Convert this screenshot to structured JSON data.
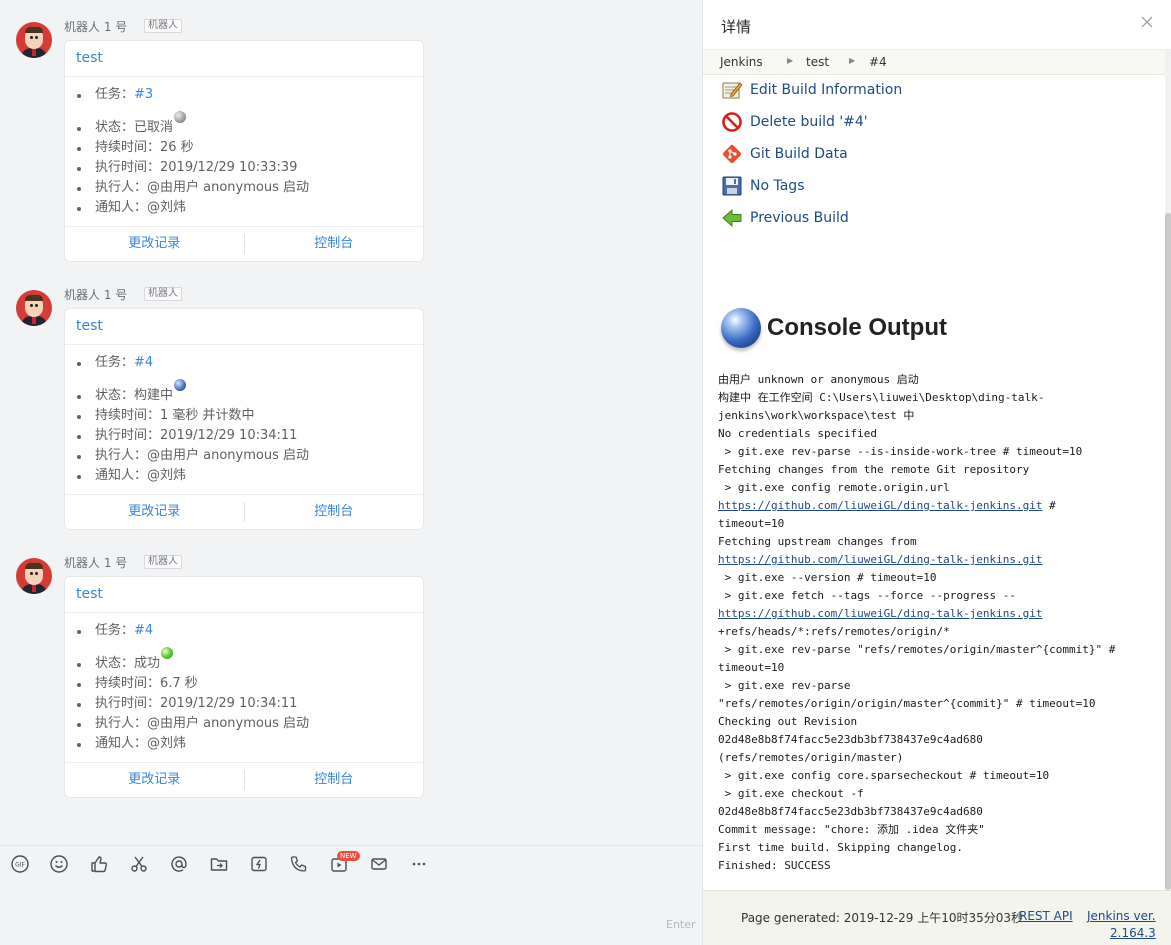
{
  "chat": {
    "messages": [
      {
        "sender": "机器人 1 号",
        "tag": "机器人",
        "title": "test",
        "task_label": "任务：",
        "task_link": "#3",
        "status_label": "状态：",
        "status": "已取消",
        "status_ball": "gray",
        "duration": "持续时间：26 秒",
        "exec_time": "执行时间：2019/12/29 10:33:39",
        "executor": "执行人：@由用户 anonymous 启动",
        "notify": "通知人：@刘炜",
        "btn_changes": "更改记录",
        "btn_console": "控制台"
      },
      {
        "sender": "机器人 1 号",
        "tag": "机器人",
        "title": "test",
        "task_label": "任务：",
        "task_link": "#4",
        "status_label": "状态：",
        "status": "构建中",
        "status_ball": "blue",
        "duration": "持续时间：1 毫秒 并计数中",
        "exec_time": "执行时间：2019/12/29 10:34:11",
        "executor": "执行人：@由用户 anonymous 启动",
        "notify": "通知人：@刘炜",
        "btn_changes": "更改记录",
        "btn_console": "控制台"
      },
      {
        "sender": "机器人 1 号",
        "tag": "机器人",
        "title": "test",
        "task_label": "任务：",
        "task_link": "#4",
        "status_label": "状态：",
        "status": "成功",
        "status_ball": "green",
        "duration": "持续时间：6.7 秒",
        "exec_time": "执行时间：2019/12/29 10:34:11",
        "executor": "执行人：@由用户 anonymous 启动",
        "notify": "通知人：@刘炜",
        "btn_changes": "更改记录",
        "btn_console": "控制台"
      }
    ],
    "toolbar": {
      "icons": [
        "gif-icon",
        "emoji-icon",
        "thumbs-up-icon",
        "scissors-icon",
        "mention-icon",
        "folder-upload-icon",
        "flash-icon",
        "phone-icon",
        "video-icon",
        "mail-icon",
        "more-icon"
      ],
      "new_badge": "NEW",
      "enter_hint": "Enter"
    }
  },
  "panel": {
    "title": "详情",
    "close_icon": "close-icon",
    "breadcrumbs": [
      "Jenkins",
      "test",
      "#4"
    ],
    "tasks": [
      {
        "label": "Edit Build Information",
        "icon": "notepad-icon"
      },
      {
        "label": "Delete build '#4'",
        "icon": "no-entry-icon"
      },
      {
        "label": "Git Build Data",
        "icon": "git-icon"
      },
      {
        "label": "No Tags",
        "icon": "save-icon"
      },
      {
        "label": "Previous Build",
        "icon": "arrow-left-icon"
      }
    ],
    "console_title": "Console Output",
    "console_lines": [
      {
        "text": "由用户 unknown or anonymous 启动",
        "link": false
      },
      {
        "text": "构建中 在工作空间 C:\\Users\\liuwei\\Desktop\\ding-talk-",
        "link": false
      },
      {
        "text": "jenkins\\work\\workspace\\test 中",
        "link": false
      },
      {
        "text": "No credentials specified",
        "link": false
      },
      {
        "text": " > git.exe rev-parse --is-inside-work-tree # timeout=10",
        "link": false
      },
      {
        "text": "Fetching changes from the remote Git repository",
        "link": false
      },
      {
        "text": " > git.exe config remote.origin.url",
        "link": false
      },
      {
        "text": "https://github.com/liuweiGL/ding-talk-jenkins.git",
        "link": true,
        "suffix": " #"
      },
      {
        "text": "timeout=10",
        "link": false
      },
      {
        "text": "Fetching upstream changes from",
        "link": false
      },
      {
        "text": "https://github.com/liuweiGL/ding-talk-jenkins.git",
        "link": true,
        "suffix": ""
      },
      {
        "text": " > git.exe --version # timeout=10",
        "link": false
      },
      {
        "text": " > git.exe fetch --tags --force --progress --",
        "link": false
      },
      {
        "text": "https://github.com/liuweiGL/ding-talk-jenkins.git",
        "link": true,
        "suffix": ""
      },
      {
        "text": "+refs/heads/*:refs/remotes/origin/*",
        "link": false
      },
      {
        "text": " > git.exe rev-parse \"refs/remotes/origin/master^{commit}\" #",
        "link": false
      },
      {
        "text": "timeout=10",
        "link": false
      },
      {
        "text": " > git.exe rev-parse",
        "link": false
      },
      {
        "text": "\"refs/remotes/origin/origin/master^{commit}\" # timeout=10",
        "link": false
      },
      {
        "text": "Checking out Revision",
        "link": false
      },
      {
        "text": "02d48e8b8f74facc5e23db3bf738437e9c4ad680",
        "link": false
      },
      {
        "text": "(refs/remotes/origin/master)",
        "link": false
      },
      {
        "text": " > git.exe config core.sparsecheckout # timeout=10",
        "link": false
      },
      {
        "text": " > git.exe checkout -f",
        "link": false
      },
      {
        "text": "02d48e8b8f74facc5e23db3bf738437e9c4ad680",
        "link": false
      },
      {
        "text": "Commit message: \"chore: 添加 .idea 文件夹\"",
        "link": false
      },
      {
        "text": "First time build. Skipping changelog.",
        "link": false
      },
      {
        "text": "Finished: SUCCESS",
        "link": false
      }
    ],
    "footer": {
      "generated": "Page generated: 2019-12-29 上午10时35分03秒",
      "rest_api": "REST API",
      "version_line1": "Jenkins ver.",
      "version_line2": "2.164.3"
    }
  }
}
